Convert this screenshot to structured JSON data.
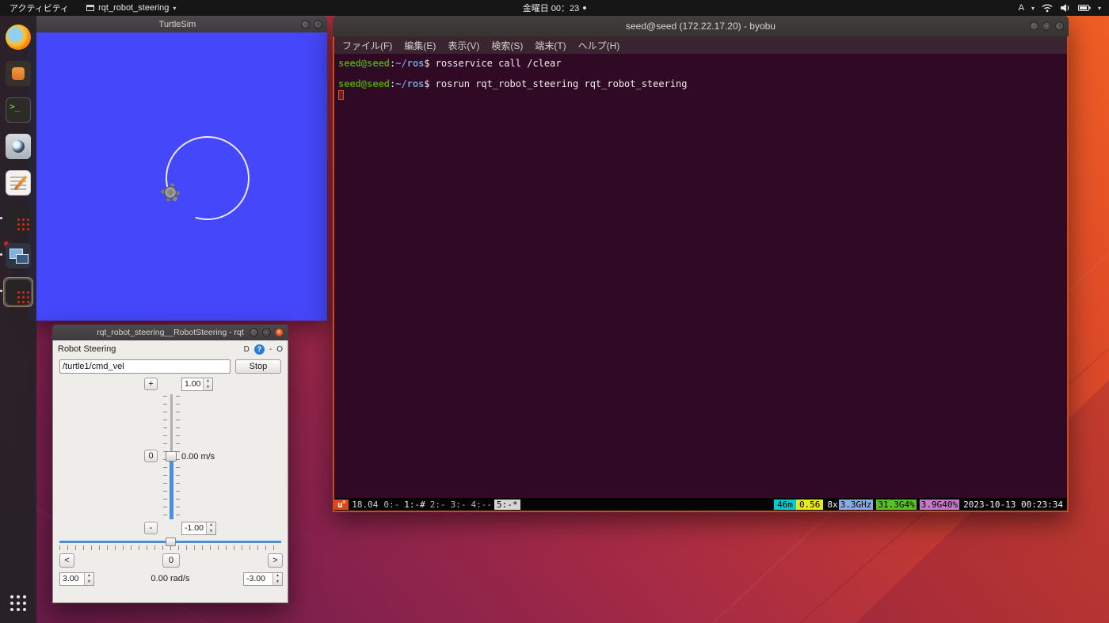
{
  "topbar": {
    "activities": "アクティビティ",
    "app_title": "rqt_robot_steering",
    "clock": "金曜日 00：23",
    "ime_label": "A"
  },
  "turtlesim": {
    "title": "TurtleSim"
  },
  "terminal": {
    "title": "seed@seed (172.22.17.20) - byobu",
    "menus": [
      "ファイル(F)",
      "編集(E)",
      "表示(V)",
      "検索(S)",
      "端末(T)",
      "ヘルプ(H)"
    ],
    "prompt_user": "seed@seed",
    "prompt_colon": ":",
    "prompt_path": "~/ros",
    "prompt_symbol": "$",
    "commands": [
      "rosservice call /clear",
      "rosrun rqt_robot_steering rqt_robot_steering"
    ],
    "statusbar": {
      "logo": "u",
      "logo_sup": "®",
      "release": "18.04",
      "win0": "0:-",
      "win1": "1:-#",
      "win2": "2:-",
      "win3": "3:-",
      "win4": "4:--",
      "win5": "5:-*",
      "uptime": "46m",
      "load": "0.56",
      "cores": "8x",
      "freq": "3.3GHz",
      "mem": "31.3G4%",
      "swap": "3.9G40%",
      "datetime": "2023-10-13 00:23:34"
    }
  },
  "rqt": {
    "window_title": "rqt_robot_steering__RobotSteering - rqt",
    "dock_title": "Robot Steering",
    "dock_buttons": {
      "dock": "D",
      "help": "?",
      "minimize": "-",
      "close": "O"
    },
    "topic_value": "/turtle1/cmd_vel",
    "stop_label": "Stop",
    "linear": {
      "plus": "+",
      "zero": "0",
      "minus": "-",
      "max": "1.00",
      "value_label": "0.00 m/s",
      "min": "-1.00"
    },
    "angular": {
      "left": "<",
      "zero": "0",
      "right": ">",
      "max": "3.00",
      "value_label": "0.00 rad/s",
      "min": "-3.00"
    }
  },
  "colors": {
    "accent_orange": "#e95420",
    "turtlesim_blue": "#4547fa",
    "terminal_bg": "#300a24",
    "prompt_green": "#4e9a06",
    "path_blue": "#729fcf"
  }
}
